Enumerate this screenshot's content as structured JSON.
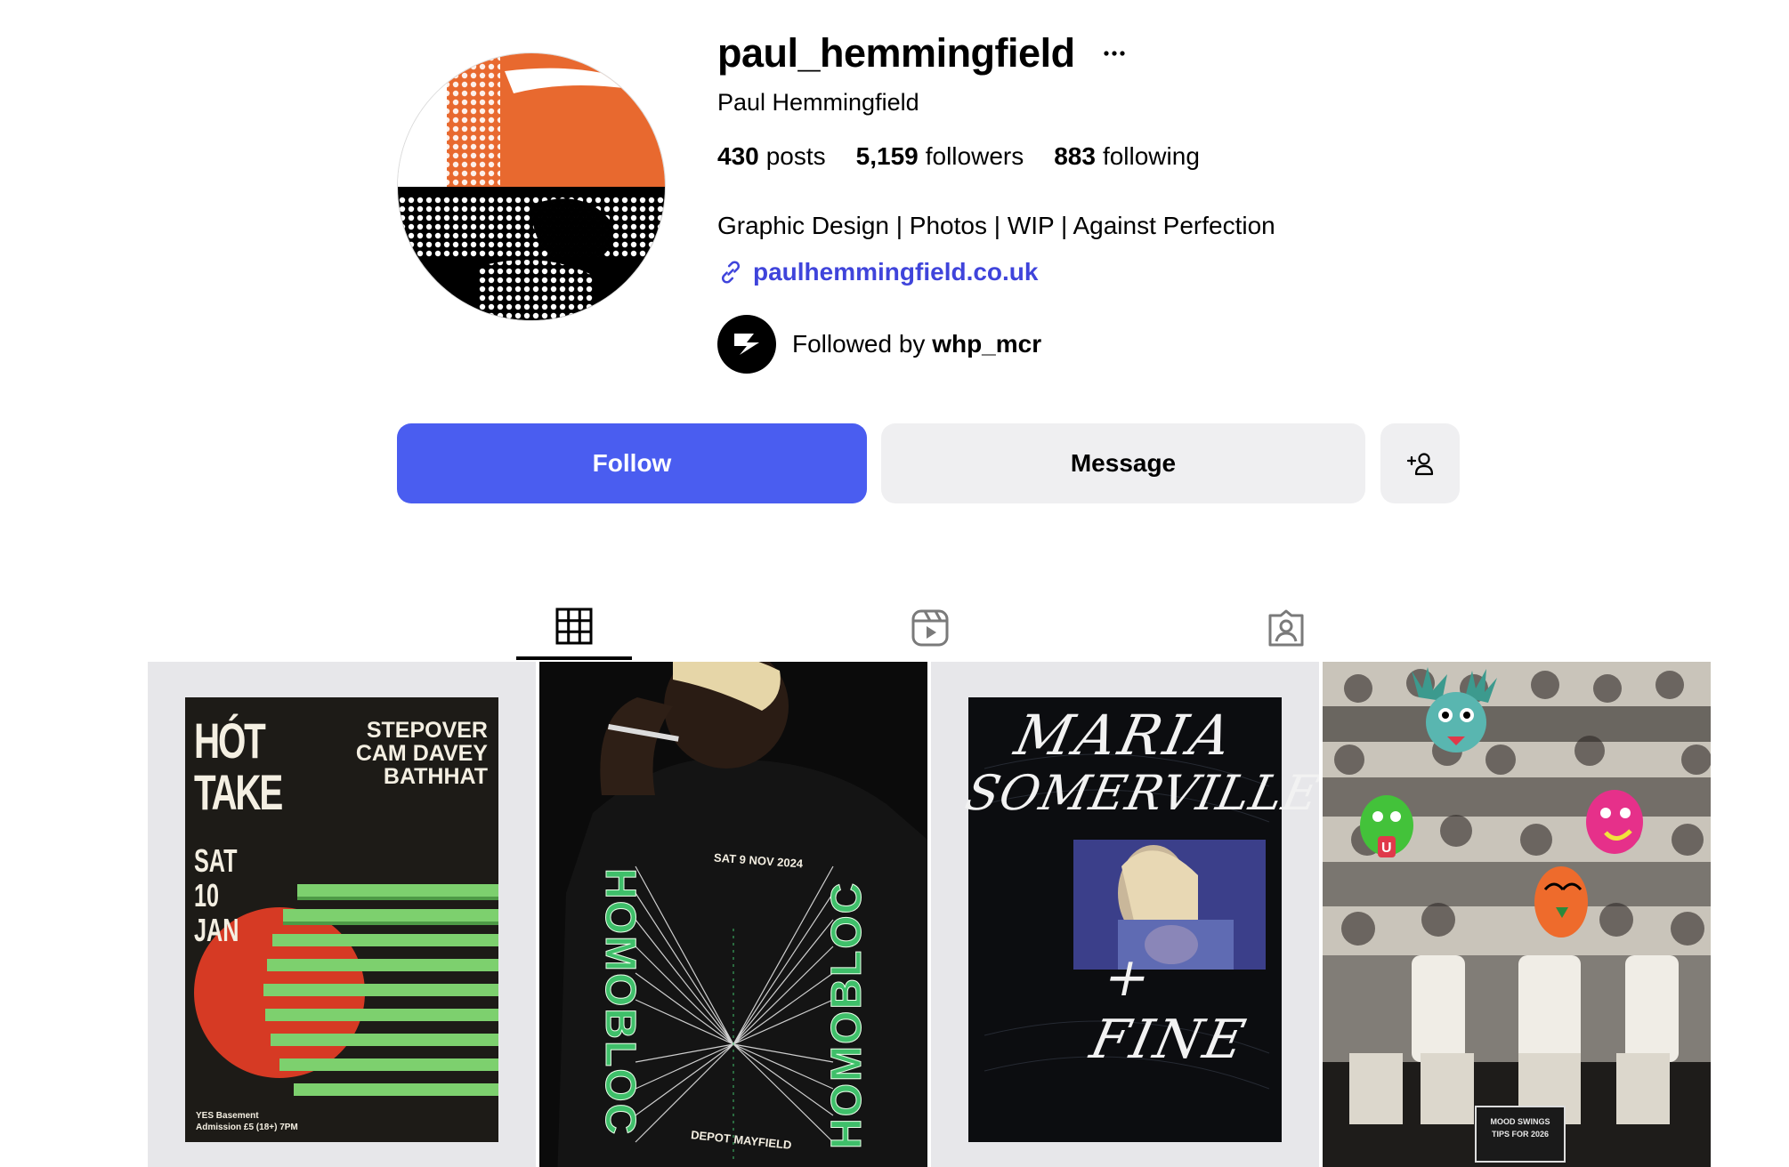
{
  "profile": {
    "username": "paul_hemmingfield",
    "full_name": "Paul Hemmingfield",
    "bio": "Graphic Design | Photos | WIP | Against Perfection",
    "link": "paulhemmingfield.co.uk",
    "followed_by_prefix": "Followed by",
    "followed_by_user": "whp_mcr"
  },
  "stats": {
    "posts_count": "430",
    "posts_label": "posts",
    "followers_count": "5,159",
    "followers_label": "followers",
    "following_count": "883",
    "following_label": "following"
  },
  "actions": {
    "follow_label": "Follow",
    "message_label": "Message"
  },
  "tabs": [
    {
      "icon": "grid-icon",
      "active": true
    },
    {
      "icon": "reels-icon",
      "active": false
    },
    {
      "icon": "tagged-icon",
      "active": false
    }
  ],
  "posts": [
    {
      "id": "hot-take",
      "title_line1": "HÓT",
      "title_line2": "TAKE",
      "date_lines": [
        "SAT",
        "10",
        "JAN"
      ],
      "lineup": [
        "STEPOVER",
        "CAM DAVEY",
        "BATHHAT"
      ],
      "venue": "YES Basement",
      "admission": "Admission £5 (18+) 7PM"
    },
    {
      "id": "homobloc",
      "date": "SAT 9 NOV 2024",
      "word": "HOMOBLOC",
      "venue": "DEPOT MAYFIELD"
    },
    {
      "id": "maria-somerville",
      "line1": "MARIA",
      "line2": "SOMERVILLE",
      "line3": "+ FINE"
    },
    {
      "id": "mood-swings",
      "sign_line1": "MOOD SWINGS",
      "sign_line2": "TIPS FOR 2026"
    }
  ],
  "colors": {
    "follow_button": "#4a5df0",
    "secondary_button": "#efeff1",
    "link": "#3f44db",
    "avatar_orange": "#e8692f"
  }
}
